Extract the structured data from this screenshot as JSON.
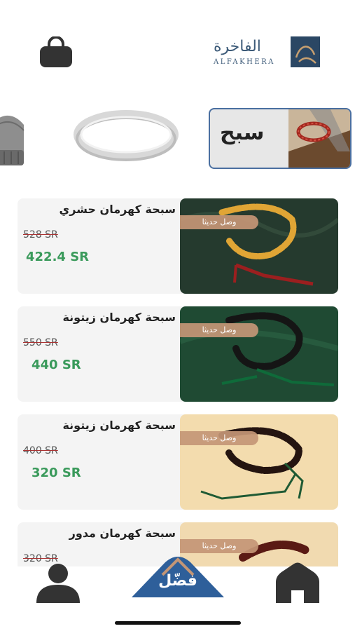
{
  "header": {
    "logo_ar": "الفاخرة",
    "logo_en": "ALFAKHERA",
    "cart_icon": "shopping-bag-icon"
  },
  "categories": [
    {
      "label": "",
      "icon": "beanie-hat-image"
    },
    {
      "label": "",
      "icon": "silver-ring-image"
    },
    {
      "label": "سبح",
      "icon": "prayer-beads-image",
      "selected": true
    }
  ],
  "badge_text": "وصل حديثا",
  "products": [
    {
      "title": "سبحة كهرمان حشري",
      "old_price": "528 SR",
      "new_price": "422.4 SR",
      "image": "amber-beads"
    },
    {
      "title": "سبحة كهرمان زيتونة",
      "old_price": "550 SR",
      "new_price": "440 SR",
      "image": "black-beads-green-tassel"
    },
    {
      "title": "سبحة كهرمان زيتونة",
      "old_price": "400 SR",
      "new_price": "320 SR",
      "image": "dark-red-beads-cream"
    },
    {
      "title": "سبحة كهرمان مدور",
      "old_price": "320 SR",
      "new_price": "",
      "image": "round-red-beads"
    }
  ],
  "nav": {
    "center_label": "فضّل",
    "items": [
      "profile-icon",
      "home-icon"
    ]
  },
  "colors": {
    "accent_green": "#3a9a5b",
    "brand_blue": "#3c5a78",
    "badge": "#c49676",
    "nav_center": "#2e5f9a"
  }
}
